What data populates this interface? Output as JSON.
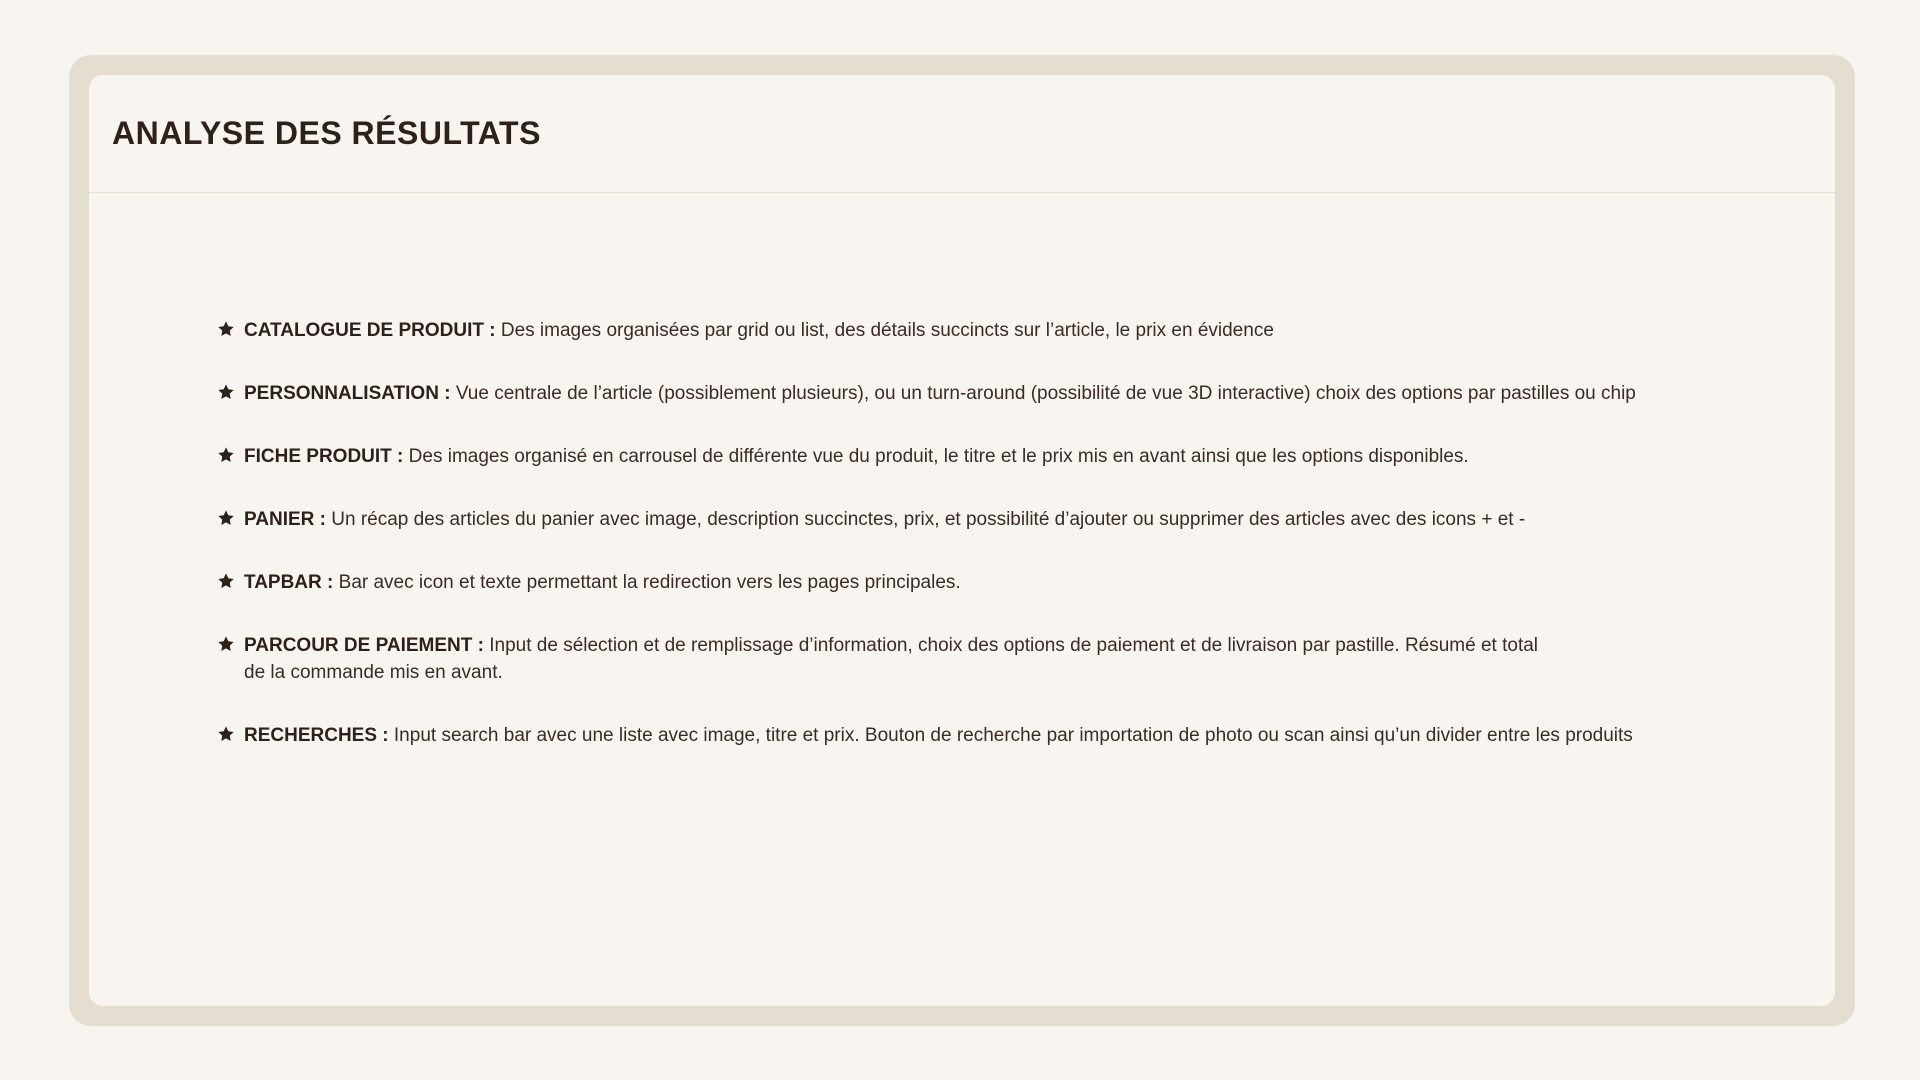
{
  "page": {
    "title": "ANALYSE DES RÉSULTATS"
  },
  "icons": {
    "bullet": "star-icon"
  },
  "colors": {
    "background": "#f8f5f1",
    "frame": "#e6ddd1",
    "text": "#2e211a"
  },
  "items": [
    {
      "label": "CATALOGUE DE PRODUIT :",
      "description": " Des images organisées par grid ou list, des détails succincts sur l’article, le prix en évidence"
    },
    {
      "label": "PERSONNALISATION :",
      "description": "Vue centrale de l’article (possiblement plusieurs), ou un turn-around (possibilité de vue 3D interactive) choix des options par pastilles ou chip"
    },
    {
      "label": "FICHE PRODUIT :",
      "description": "Des images organisé en carrousel de différente vue du produit, le titre et le prix mis en avant ainsi que les options disponibles."
    },
    {
      "label": "PANIER :",
      "description": "Un récap des articles du panier avec image, description succinctes, prix, et possibilité d’ajouter ou supprimer des articles avec des icons + et -"
    },
    {
      "label": "TAPBAR :",
      "description": "Bar avec icon et texte permettant la redirection vers les pages principales."
    },
    {
      "label": "PARCOUR DE PAIEMENT :",
      "description": "Input de sélection et de remplissage d’information, choix des options de paiement et de livraison par pastille. Résumé et total de la commande mis en avant."
    },
    {
      "label": "RECHERCHES :",
      "description": "Input search bar avec une liste avec image, titre et prix. Bouton de recherche par importation de photo ou scan ainsi qu’un divider entre les produits"
    }
  ]
}
